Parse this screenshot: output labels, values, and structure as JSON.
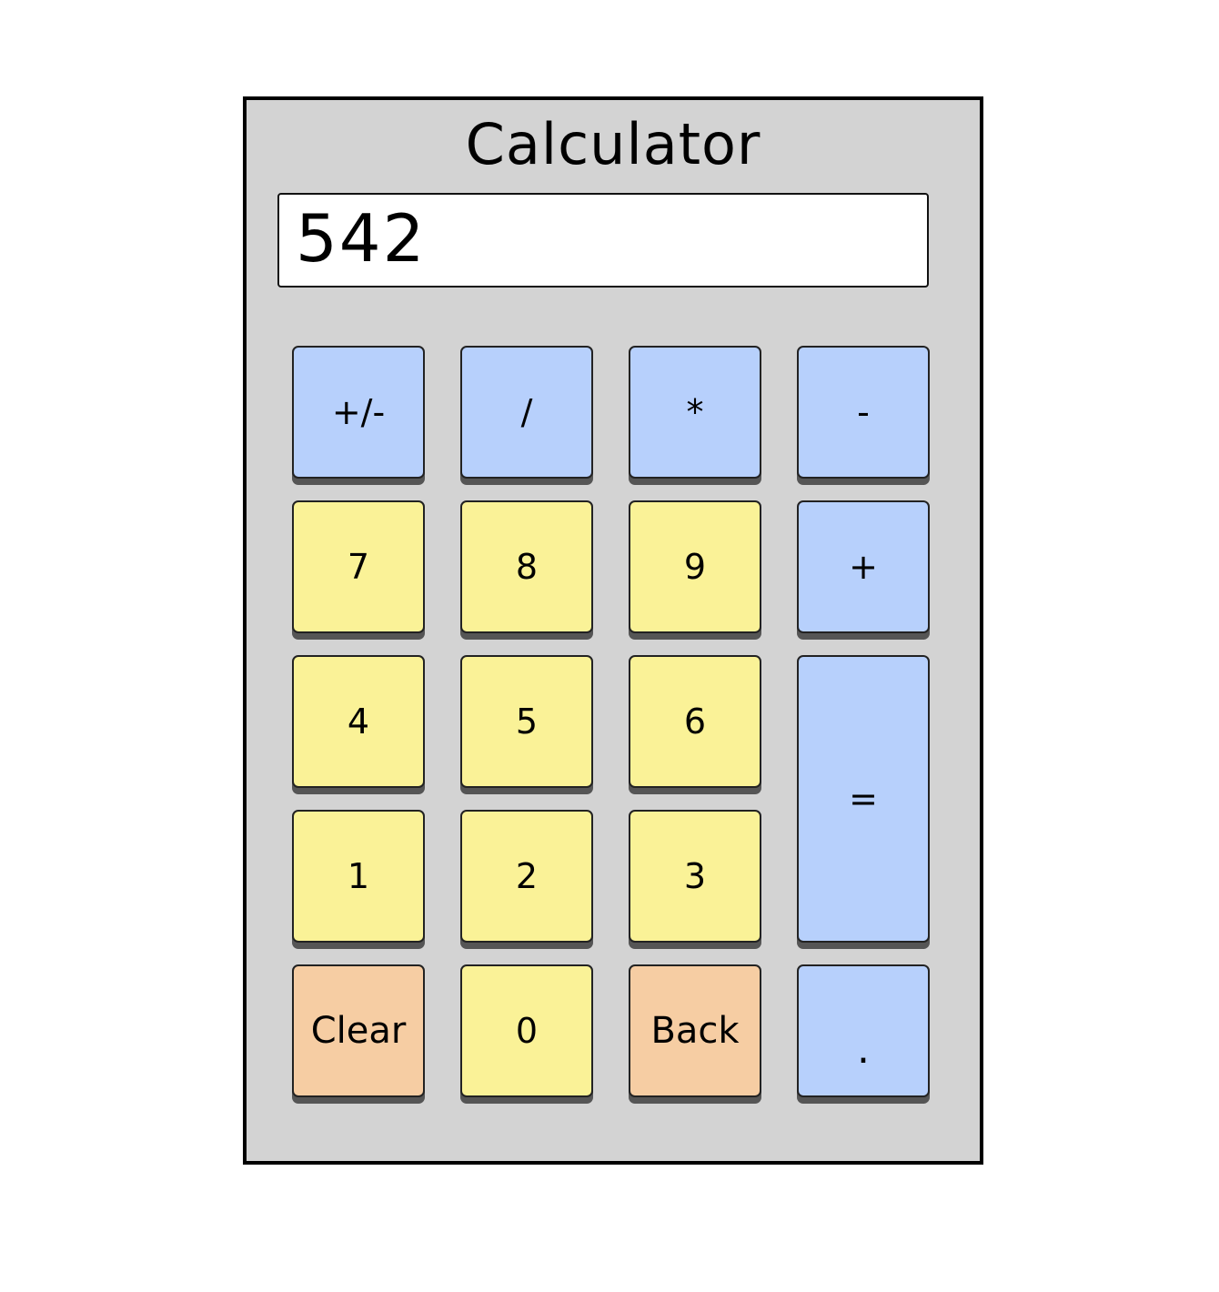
{
  "title": "Calculator",
  "display": {
    "value": "542"
  },
  "colors": {
    "operator": "#b7d0fc",
    "digit": "#faf297",
    "function": "#f6cda3",
    "body": "#d3d3d3"
  },
  "keys": {
    "sign": "+/-",
    "divide": "/",
    "multiply": "*",
    "subtract": "-",
    "seven": "7",
    "eight": "8",
    "nine": "9",
    "add": "+",
    "four": "4",
    "five": "5",
    "six": "6",
    "equals": "=",
    "one": "1",
    "two": "2",
    "three": "3",
    "clear": "Clear",
    "zero": "0",
    "back": "Back",
    "decimal": "."
  }
}
